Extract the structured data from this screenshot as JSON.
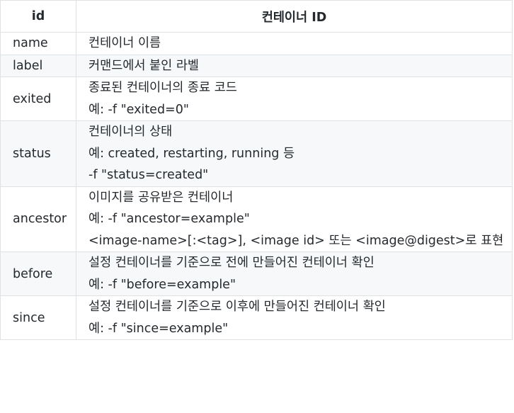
{
  "header": {
    "col_key": "id",
    "col_desc": "컨테이너 ID"
  },
  "rows": [
    {
      "key": "name",
      "lines": [
        "컨테이너 이름"
      ]
    },
    {
      "key": "label",
      "lines": [
        "커맨드에서 붙인 라벨"
      ]
    },
    {
      "key": "exited",
      "lines": [
        "종료된 컨테이너의 종료 코드",
        "예: -f \"exited=0\""
      ]
    },
    {
      "key": "status",
      "lines": [
        "컨테이너의 상태",
        "예: created, restarting, running 등",
        "-f \"status=created\""
      ]
    },
    {
      "key": "ancestor",
      "lines": [
        "이미지를 공유받은 컨테이너",
        "예: -f \"ancestor=example\"",
        "<image-name>[:<tag>], <image id> 또는 <image@digest>로 표현"
      ]
    },
    {
      "key": "before",
      "lines": [
        "설정 컨테이너를 기준으로 전에 만들어진 컨테이너 확인",
        "예: -f \"before=example\""
      ]
    },
    {
      "key": "since",
      "lines": [
        "설정 컨테이너를 기준으로 이후에 만들어진 컨테이너 확인",
        "예: -f \"since=example\""
      ]
    }
  ]
}
